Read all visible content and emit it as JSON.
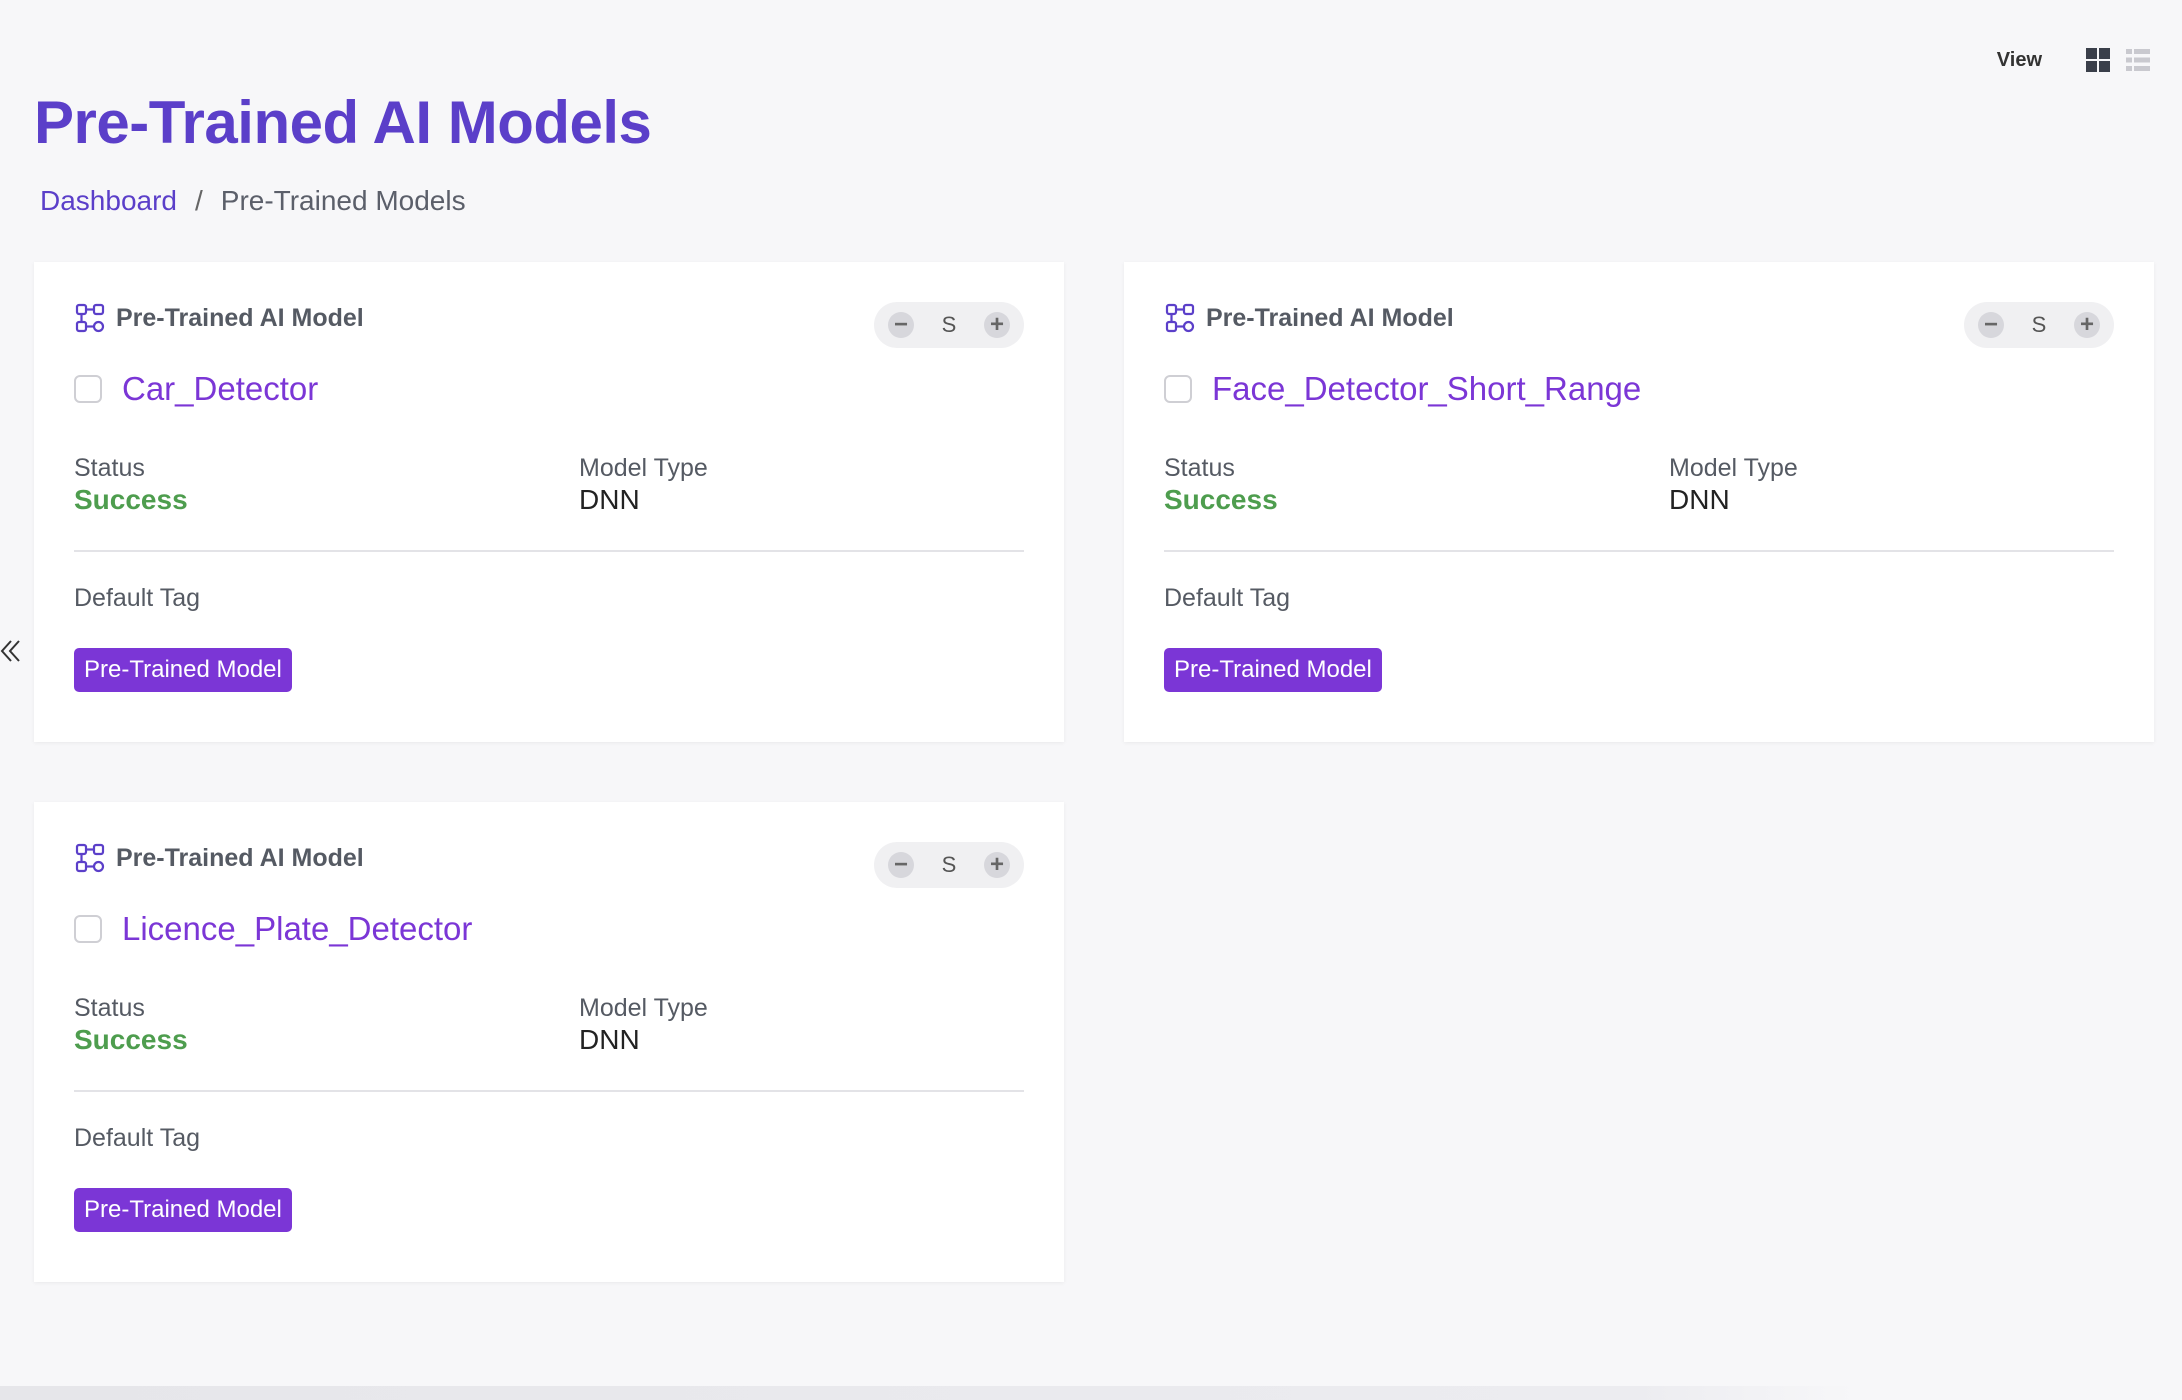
{
  "header": {
    "view_label": "View",
    "title": "Pre-Trained AI Models"
  },
  "breadcrumb": {
    "home": "Dashboard",
    "separator": "/",
    "current": "Pre-Trained Models"
  },
  "icons": {
    "grid_view": "grid-view-icon",
    "list_view": "list-view-icon",
    "collapse": "double-chevron-left-icon",
    "model": "model-nodes-icon"
  },
  "colors": {
    "accent": "#5b3fc9",
    "model_name": "#7b36d6",
    "success": "#4e9d4e",
    "tag_bg": "#7b36d6"
  },
  "cards": [
    {
      "header_label": "Pre-Trained AI Model",
      "size_label": "S",
      "name": "Car_Detector",
      "status_label": "Status",
      "status_value": "Success",
      "type_label": "Model Type",
      "type_value": "DNN",
      "tag_label": "Default Tag",
      "tag": "Pre-Trained Model"
    },
    {
      "header_label": "Pre-Trained AI Model",
      "size_label": "S",
      "name": "Face_Detector_Short_Range",
      "status_label": "Status",
      "status_value": "Success",
      "type_label": "Model Type",
      "type_value": "DNN",
      "tag_label": "Default Tag",
      "tag": "Pre-Trained Model"
    },
    {
      "header_label": "Pre-Trained AI Model",
      "size_label": "S",
      "name": "Licence_Plate_Detector",
      "status_label": "Status",
      "status_value": "Success",
      "type_label": "Model Type",
      "type_value": "DNN",
      "tag_label": "Default Tag",
      "tag": "Pre-Trained Model"
    }
  ]
}
